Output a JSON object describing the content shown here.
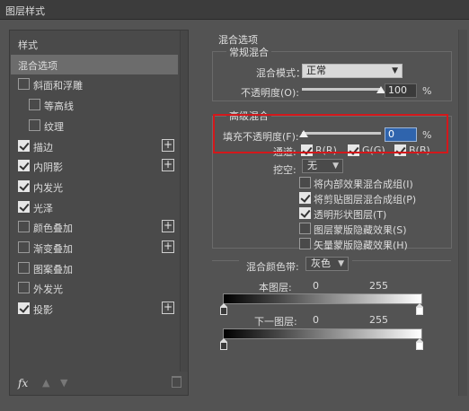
{
  "window": {
    "title": "图层样式"
  },
  "left_panel": {
    "items": [
      {
        "label": "样式",
        "checkbox": false,
        "checked": false,
        "plus": false,
        "selected": false,
        "indent": 0
      },
      {
        "label": "混合选项",
        "checkbox": false,
        "checked": false,
        "plus": false,
        "selected": true,
        "indent": 0
      },
      {
        "label": "斜面和浮雕",
        "checkbox": true,
        "checked": false,
        "plus": false,
        "selected": false,
        "indent": 0
      },
      {
        "label": "等高线",
        "checkbox": true,
        "checked": false,
        "plus": false,
        "selected": false,
        "indent": 1
      },
      {
        "label": "纹理",
        "checkbox": true,
        "checked": false,
        "plus": false,
        "selected": false,
        "indent": 1
      },
      {
        "label": "描边",
        "checkbox": true,
        "checked": true,
        "plus": true,
        "selected": false,
        "indent": 0
      },
      {
        "label": "内阴影",
        "checkbox": true,
        "checked": true,
        "plus": true,
        "selected": false,
        "indent": 0
      },
      {
        "label": "内发光",
        "checkbox": true,
        "checked": true,
        "plus": false,
        "selected": false,
        "indent": 0
      },
      {
        "label": "光泽",
        "checkbox": true,
        "checked": true,
        "plus": false,
        "selected": false,
        "indent": 0
      },
      {
        "label": "颜色叠加",
        "checkbox": true,
        "checked": false,
        "plus": true,
        "selected": false,
        "indent": 0
      },
      {
        "label": "渐变叠加",
        "checkbox": true,
        "checked": false,
        "plus": true,
        "selected": false,
        "indent": 0
      },
      {
        "label": "图案叠加",
        "checkbox": true,
        "checked": false,
        "plus": false,
        "selected": false,
        "indent": 0
      },
      {
        "label": "外发光",
        "checkbox": true,
        "checked": false,
        "plus": false,
        "selected": false,
        "indent": 0
      },
      {
        "label": "投影",
        "checkbox": true,
        "checked": true,
        "plus": true,
        "selected": false,
        "indent": 0
      }
    ],
    "footer": {
      "fx_label": "fx",
      "up_icon": "arrow-up-icon",
      "down_icon": "arrow-down-icon",
      "trash_icon": "trash-icon"
    }
  },
  "blend_options": {
    "section_title": "混合选项",
    "general": {
      "legend": "常规混合",
      "blend_mode_label": "混合模式：",
      "blend_mode_value": "正常",
      "opacity_label": "不透明度(O):",
      "opacity_value": "100",
      "opacity_unit": "%",
      "opacity_level": 1.0
    },
    "advanced": {
      "legend": "高级混合",
      "fill_opacity_label": "填充不透明度(F):",
      "fill_opacity_value": "0",
      "fill_opacity_unit": "%",
      "fill_opacity_level": 0.0,
      "channels_label": "通道:",
      "channel_r": "R(R)",
      "channel_g": "G(G)",
      "channel_b": "B(B)",
      "knockout_label": "挖空:",
      "knockout_value": "无",
      "options": [
        {
          "label": "将内部效果混合成组(I)",
          "checked": false
        },
        {
          "label": "将剪贴图层混合成组(P)",
          "checked": true
        },
        {
          "label": "透明形状图层(T)",
          "checked": true
        },
        {
          "label": "图层蒙版隐藏效果(S)",
          "checked": false
        },
        {
          "label": "矢量蒙版隐藏效果(H)",
          "checked": false
        }
      ]
    },
    "blend_if": {
      "label": "混合颜色带:",
      "value": "灰色",
      "this_layer_label": "本图层:",
      "this_layer_min": "0",
      "this_layer_max": "255",
      "underlying_label": "下一图层:",
      "underlying_min": "0",
      "underlying_max": "255"
    }
  },
  "colors": {
    "highlight_box": "#d3181b",
    "active_field": "#2f64ad"
  }
}
